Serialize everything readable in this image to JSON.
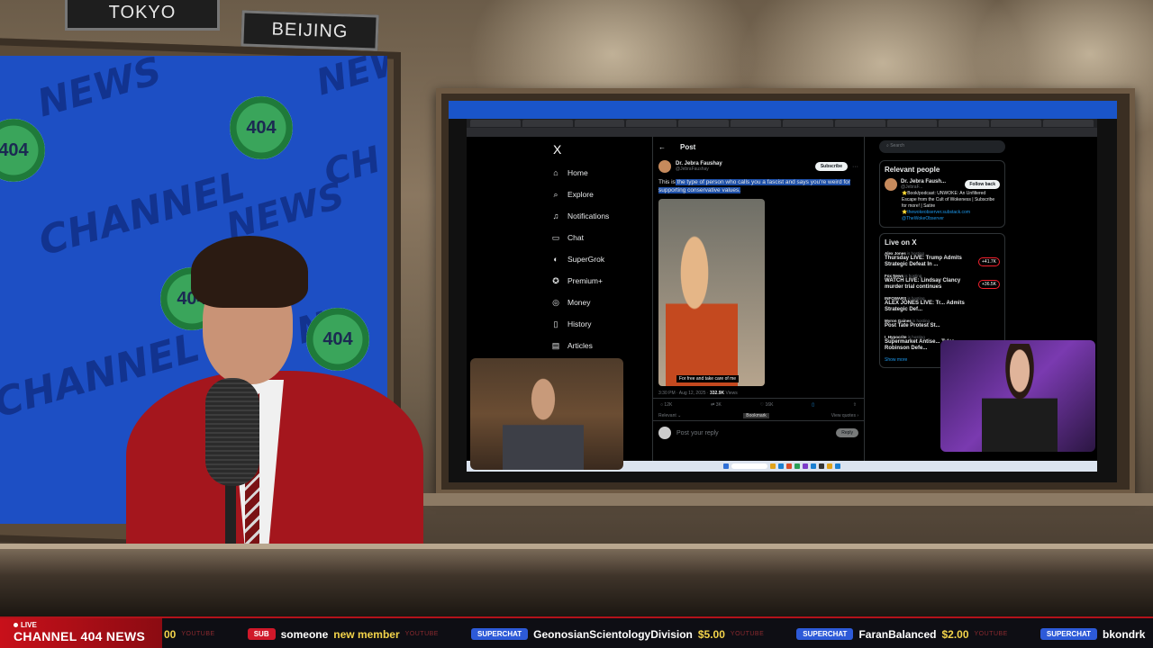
{
  "studio": {
    "city_labels": [
      "TOKYO",
      "BEIJING"
    ]
  },
  "backdrop": {
    "words": [
      "NEWS",
      "CHANNEL",
      "NEWS",
      "CH",
      "CHANNEL",
      "N",
      "CHANNEL",
      "NEWS"
    ],
    "logo_text": "404"
  },
  "browser": {
    "tabs": [
      "",
      "",
      "",
      "",
      "",
      "",
      "",
      "",
      "",
      "",
      "",
      "",
      "",
      "",
      ""
    ]
  },
  "x": {
    "logo": "X",
    "nav": [
      {
        "icon": "home-icon",
        "glyph": "⌂",
        "label": "Home"
      },
      {
        "icon": "search-icon",
        "glyph": "⌕",
        "label": "Explore"
      },
      {
        "icon": "bell-icon",
        "glyph": "♫",
        "label": "Notifications"
      },
      {
        "icon": "chat-icon",
        "glyph": "▭",
        "label": "Chat"
      },
      {
        "icon": "grok-icon",
        "glyph": "◐",
        "label": "SuperGrok"
      },
      {
        "icon": "premium-icon",
        "glyph": "✪",
        "label": "Premium+"
      },
      {
        "icon": "money-icon",
        "glyph": "◎",
        "label": "Money"
      },
      {
        "icon": "history-icon",
        "glyph": "▯",
        "label": "History"
      },
      {
        "icon": "articles-icon",
        "glyph": "▤",
        "label": "Articles"
      }
    ],
    "post": {
      "header": "Post",
      "author_name": "Dr. Jebra Faushay",
      "author_handle": "@JebraFaushay",
      "subscribe_label": "Subscribe",
      "text_pre": "This is",
      "text_highlight": " the type of person who calls you a fascist and says you're weird for supporting conservative values.",
      "caption": "For free and take care of me",
      "timestamp": "3:30 PM · Aug 12, 2025 · ",
      "views": "332.9K",
      "views_label": "Views",
      "replies": "12K",
      "reposts": "3K",
      "likes": "16K",
      "bookmark_tooltip": "Bookmark",
      "relevant_label": "Relevant ⌄",
      "view_quotes": "View quotes ›",
      "reply_placeholder": "Post your reply",
      "reply_button": "Reply"
    },
    "sidebar": {
      "search_placeholder": "Search",
      "relevant_title": "Relevant people",
      "person_name": "Dr. Jebra Faush...",
      "person_handle": "@JebraF...",
      "follow_label": "Follow back",
      "bio": "⭐Book/podcast: UNWOKE: An Unfiltered Escape from the Cult of Wokeness | Subscribe for more! | Satire",
      "bio_link": "⭐thewokeobserver.substack.com",
      "bio_mention": "@TheWokeObserver",
      "live_title": "Live on X",
      "live": [
        {
          "host": "Alex Jones",
          "status": " is hosting",
          "title": "Thursday LIVE: Trump Admits Strategic Defeat In ...",
          "count": "+41.7K"
        },
        {
          "host": "Fox News",
          "status": " is hosting",
          "title": "WATCH LIVE: Lindsay Clancy murder trial continues",
          "count": "+36.5K"
        },
        {
          "host": "INFOWARS",
          "status": " is hosting",
          "title": "ALEX JONES LIVE: Tr... Admits Strategic Def...",
          "count": ""
        },
        {
          "host": "Myron Gaines",
          "status": " is hosting",
          "title": "Post Tate Protest St...",
          "count": ""
        },
        {
          "host": "I_Hypocrite",
          "status": " is hosting",
          "title": "Supermarket Antise... Tyler Robinson Defe...",
          "count": ""
        }
      ],
      "show_more": "Show more"
    }
  },
  "ticker": {
    "live_label": "LIVE",
    "channel_name": "CHANNEL 404 NEWS",
    "items": [
      {
        "type": "tail",
        "amount": "00",
        "platform": "YOUTUBE"
      },
      {
        "type": "sub",
        "badge": "SUB",
        "user": "someone",
        "extra": "new member",
        "platform": "YOUTUBE"
      },
      {
        "type": "chat",
        "badge": "SUPERCHAT",
        "user": "GeonosianScientologyDivision",
        "extra": "$5.00",
        "platform": "YOUTUBE"
      },
      {
        "type": "chat",
        "badge": "SUPERCHAT",
        "user": "FaranBalanced",
        "extra": "$2.00",
        "platform": "YOUTUBE"
      },
      {
        "type": "chat",
        "badge": "SUPERCHAT",
        "user": "bkondrk",
        "extra": "",
        "platform": ""
      }
    ]
  },
  "colors": {
    "ticker_red": "#c8101a",
    "superchat_blue": "#2d5ad8",
    "amount_yellow": "#f3d34a",
    "host_jacket": "#a4161d",
    "backdrop_blue": "#1d4fc4"
  }
}
